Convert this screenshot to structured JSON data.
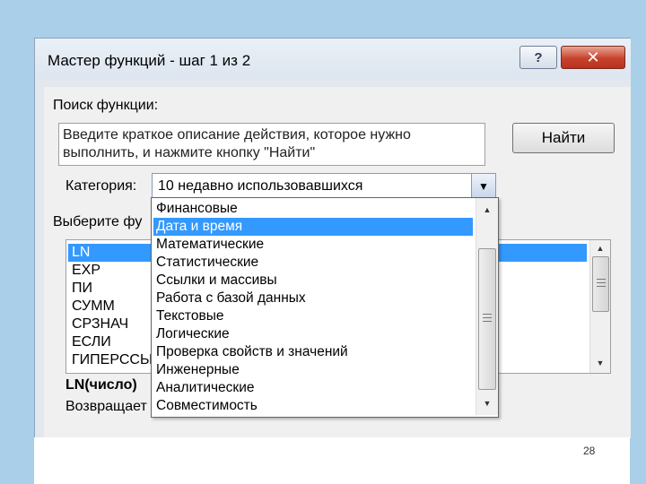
{
  "window": {
    "title": "Мастер функций - шаг 1 из 2",
    "help_label": "?",
    "close_label": "✕"
  },
  "search": {
    "label": "Поиск функции:",
    "text": "Введите краткое описание действия, которое нужно выполнить, и нажмите кнопку \"Найти\"",
    "find_label": "Найти"
  },
  "category": {
    "label": "Категория:",
    "selected": "10 недавно использовавшихся",
    "options": [
      "Финансовые",
      "Дата и время",
      "Математические",
      "Статистические",
      "Ссылки и массивы",
      "Работа с базой данных",
      "Текстовые",
      "Логические",
      "Проверка свойств и значений",
      "Инженерные",
      "Аналитические",
      "Совместимость"
    ],
    "highlighted_index": 1
  },
  "functions": {
    "label": "Выберите фу",
    "items": [
      "LN",
      "EXP",
      "ПИ",
      "СУММ",
      "СРЗНАЧ",
      "ЕСЛИ",
      "ГИПЕРССЫЛ"
    ],
    "selected_index": 0
  },
  "details": {
    "signature": "LN(число)",
    "description": "Возвращает"
  },
  "slide": {
    "page_number": "28"
  }
}
